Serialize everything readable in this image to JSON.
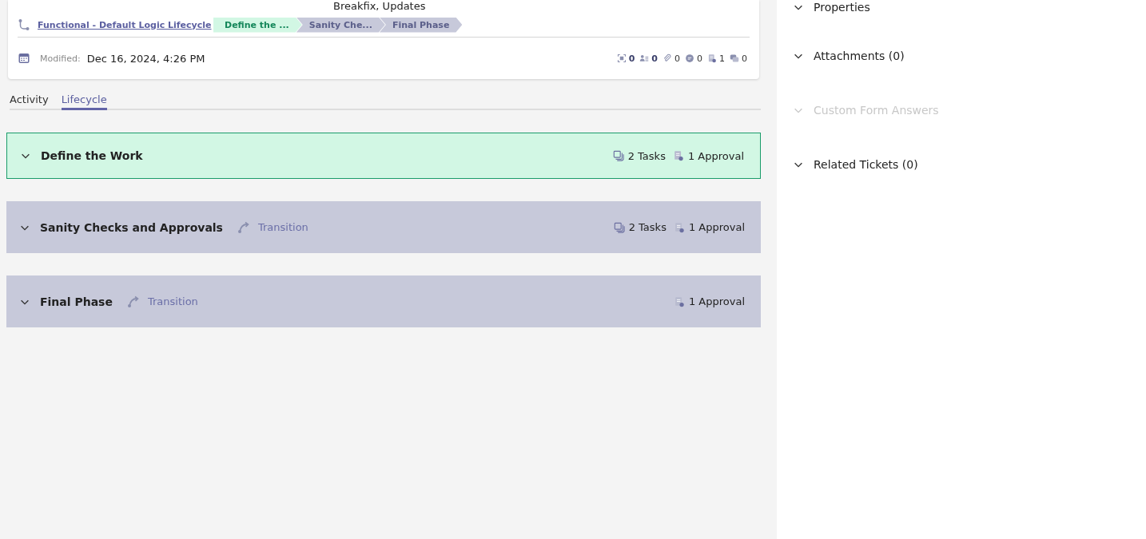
{
  "card": {
    "tags_value": "Breakfix, Updates",
    "lifecycle_link": "Functional - Default Logic Lifecycle",
    "stages": [
      {
        "label": "Define the ...",
        "active": true
      },
      {
        "label": "Sanity Che...",
        "active": false
      },
      {
        "label": "Final Phase",
        "active": false
      }
    ],
    "modified_label": "Modified:",
    "modified_value": "Dec 16, 2024, 4:26 PM",
    "stats": [
      {
        "kind": "scan",
        "count": "0"
      },
      {
        "kind": "people",
        "count": "0"
      },
      {
        "kind": "clip",
        "count": "0"
      },
      {
        "kind": "comment",
        "count": "0"
      },
      {
        "kind": "approval",
        "count": "1"
      },
      {
        "kind": "chat",
        "count": "0"
      }
    ]
  },
  "tabs": [
    {
      "label": "Activity",
      "selected": false
    },
    {
      "label": "Lifecycle",
      "selected": true
    }
  ],
  "phases": [
    {
      "title": "Define the Work",
      "active": true,
      "counts": [
        {
          "kind": "tasks",
          "text": "2 Tasks"
        },
        {
          "kind": "approval",
          "text": "1 Approval"
        }
      ]
    },
    {
      "title": "Sanity Checks and Approvals",
      "active": false,
      "transition": "Transition",
      "counts": [
        {
          "kind": "tasks",
          "text": "2 Tasks"
        },
        {
          "kind": "approval",
          "text": "1 Approval"
        }
      ]
    },
    {
      "title": "Final Phase",
      "active": false,
      "transition": "Transition",
      "counts": [
        {
          "kind": "approval",
          "text": "1 Approval"
        }
      ]
    }
  ],
  "side_sections": [
    {
      "label": "Properties",
      "disabled": false
    },
    {
      "label": "Attachments (0)",
      "disabled": false
    },
    {
      "label": "Custom Form Answers",
      "disabled": true
    },
    {
      "label": "Related Tickets (0)",
      "disabled": false
    }
  ]
}
